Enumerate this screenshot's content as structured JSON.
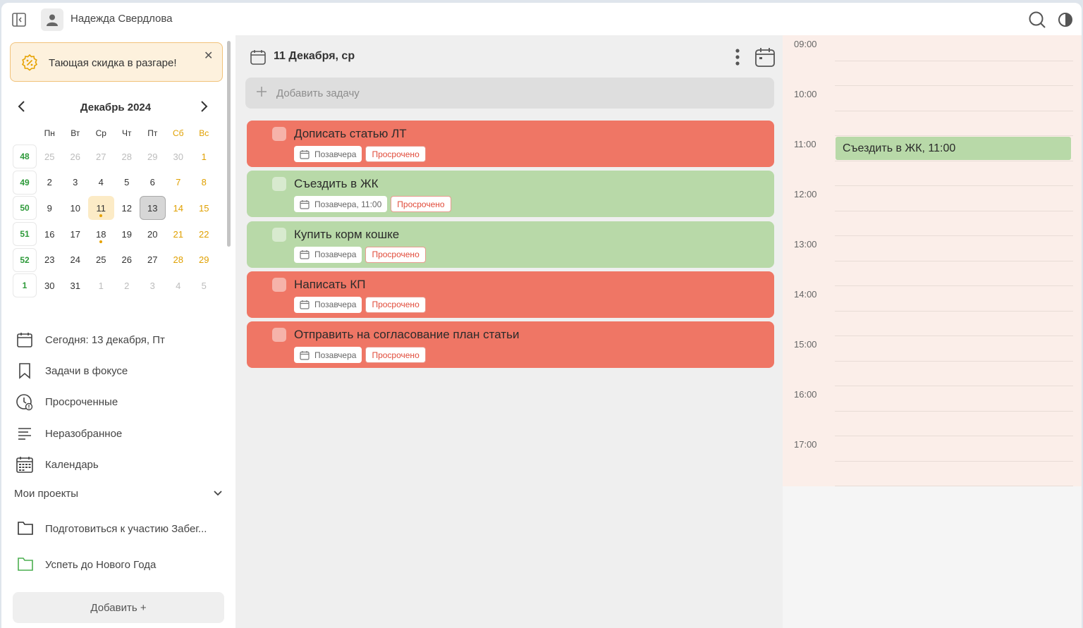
{
  "header": {
    "user_name": "Надежда Свердлова",
    "collapse_icon": "sidebar-collapse-icon",
    "search_icon": "search-icon",
    "theme_icon": "contrast-icon"
  },
  "promo": {
    "text": "Тающая скидка в разгаре!",
    "close": "✕",
    "accent": "#f1c27a"
  },
  "calendar": {
    "month_label": "Декабрь 2024",
    "prev": "‹",
    "next": "›",
    "weekdays": [
      "Пн",
      "Вт",
      "Ср",
      "Чт",
      "Пт",
      "Сб",
      "Вс"
    ],
    "weeks": [
      {
        "num": "48",
        "days": [
          "25",
          "26",
          "27",
          "28",
          "29",
          "30",
          "1"
        ]
      },
      {
        "num": "49",
        "days": [
          "2",
          "3",
          "4",
          "5",
          "6",
          "7",
          "8"
        ]
      },
      {
        "num": "50",
        "days": [
          "9",
          "10",
          "11",
          "12",
          "13",
          "14",
          "15"
        ]
      },
      {
        "num": "51",
        "days": [
          "16",
          "17",
          "18",
          "19",
          "20",
          "21",
          "22"
        ]
      },
      {
        "num": "52",
        "days": [
          "23",
          "24",
          "25",
          "26",
          "27",
          "28",
          "29"
        ]
      },
      {
        "num": "1",
        "days": [
          "30",
          "31",
          "1",
          "2",
          "3",
          "4",
          "5"
        ]
      }
    ],
    "highlighted_day": "11",
    "selected_day": "13",
    "days_with_dot": [
      "11",
      "18"
    ]
  },
  "nav": {
    "today": "Сегодня: 13 декабря, Пт",
    "focus": "Задачи в фокусе",
    "overdue": "Просроченные",
    "inbox": "Неразобранное",
    "calendar": "Календарь"
  },
  "projects": {
    "header": "Мои проекты",
    "items": [
      {
        "label": "Подготовиться к участию Забег...",
        "color": "#333333"
      },
      {
        "label": "Успеть до Нового Года",
        "color": "#4caf50"
      }
    ],
    "add_label": "Добавить +"
  },
  "main": {
    "date_title": "11 Декабря, ср",
    "add_task_placeholder": "Добавить задачу",
    "tasks": [
      {
        "title": "Дописать статью ЛТ",
        "date": "Позавчера",
        "status": "Просрочено",
        "color": "red"
      },
      {
        "title": "Съездить в ЖК",
        "date": "Позавчера, 11:00",
        "status": "Просрочено",
        "color": "green"
      },
      {
        "title": "Купить корм кошке",
        "date": "Позавчера",
        "status": "Просрочено",
        "color": "green"
      },
      {
        "title": "Написать КП",
        "date": "Позавчера",
        "status": "Просрочено",
        "color": "red"
      },
      {
        "title": "Отправить на согласование план статьи",
        "date": "Позавчера",
        "status": "Просрочено",
        "color": "red"
      }
    ]
  },
  "timeline": {
    "hours": [
      "09:00",
      "10:00",
      "11:00",
      "12:00",
      "13:00",
      "14:00",
      "15:00",
      "16:00",
      "17:00"
    ],
    "event": {
      "label": "Съездить в ЖК, 11:00",
      "color": "#b8d9a8"
    }
  }
}
